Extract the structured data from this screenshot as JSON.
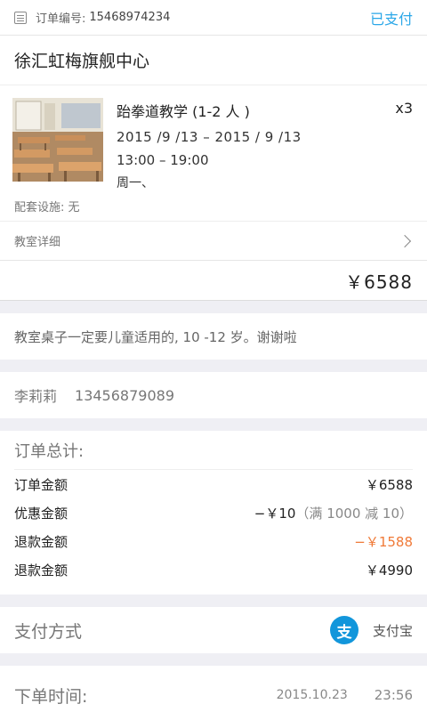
{
  "header": {
    "order_label": "订单编号:",
    "order_no": "15468974234",
    "status": "已支付",
    "icon": "order-doc-icon"
  },
  "store": {
    "name": "徐汇虹梅旗舰中心"
  },
  "item": {
    "name": "跆拳道教学 (1-2 人 )",
    "dates": "2015 /9 /13  –  2015 / 9 /13",
    "time": "13:00  –  19:00",
    "weekday": "周一、",
    "qty": "x3",
    "facility": "配套设施: 无",
    "thumbnail_icon": "classroom-photo"
  },
  "detail": {
    "label": "教室详细",
    "icon": "chevron-right-icon"
  },
  "price": {
    "total": "￥6588"
  },
  "note": {
    "text": "教室桌子一定要儿童适用的, 10 -12 岁。谢谢啦"
  },
  "contact": {
    "name": "李莉莉",
    "phone": "13456879089"
  },
  "summary": {
    "title": "订单总计:",
    "rows": [
      {
        "label": "订单金额",
        "value": "￥6588",
        "extra": ""
      },
      {
        "label": "优惠金额",
        "value": "−￥10",
        "extra": "（满 1000 减 10）"
      },
      {
        "label": "退款金额",
        "value": "−￥1588",
        "extra": ""
      },
      {
        "label": "退款金额",
        "value": "￥4990",
        "extra": ""
      }
    ]
  },
  "payment": {
    "title": "支付方式",
    "method": "支付宝",
    "icon_glyph": "支",
    "icon": "alipay-icon"
  },
  "order_time": {
    "title": "下单时间:",
    "date": "2015.10.23",
    "time": "23:56"
  },
  "colors": {
    "accent": "#2aa7e8",
    "refund": "#f07a38",
    "alipay": "#1296db"
  }
}
